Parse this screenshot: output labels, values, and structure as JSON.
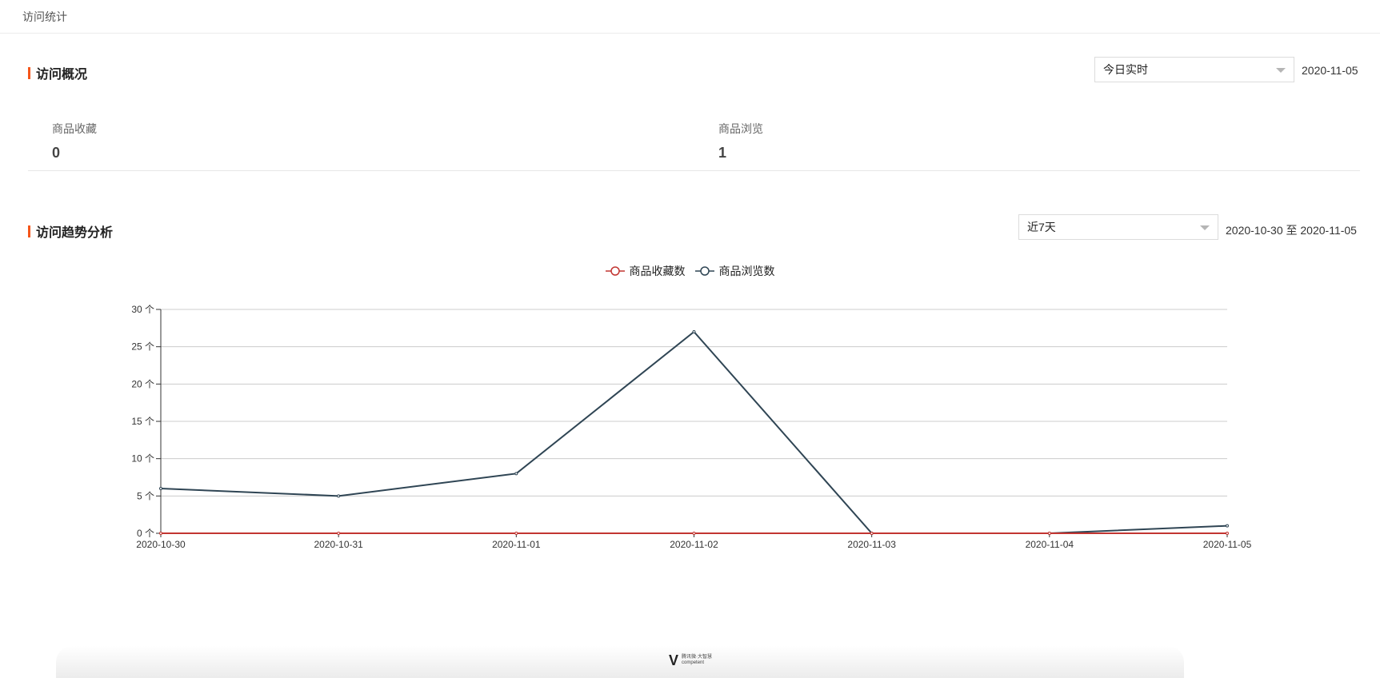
{
  "header": {
    "title": "访问统计"
  },
  "overview": {
    "title": "访问概况",
    "select_value": "今日实时",
    "date": "2020-11-05",
    "stats": [
      {
        "label": "商品收藏",
        "value": "0"
      },
      {
        "label": "商品浏览",
        "value": "1"
      }
    ]
  },
  "trend": {
    "title": "访问趋势分析",
    "select_value": "近7天",
    "date_range": "2020-10-30 至 2020-11-05"
  },
  "colors": {
    "accent": "#f5561b",
    "series_favorites": "#c23531",
    "series_views": "#2f4554",
    "grid": "#cccccc"
  },
  "chart_data": {
    "type": "line",
    "categories": [
      "2020-10-30",
      "2020-10-31",
      "2020-11-01",
      "2020-11-02",
      "2020-11-03",
      "2020-11-04",
      "2020-11-05"
    ],
    "series": [
      {
        "name": "商品收藏数",
        "values": [
          0,
          0,
          0,
          0,
          0,
          0,
          0
        ]
      },
      {
        "name": "商品浏览数",
        "values": [
          6,
          5,
          8,
          27,
          0,
          0,
          1
        ]
      }
    ],
    "yticks": [
      "0 个",
      "5 个",
      "10 个",
      "15 个",
      "20 个",
      "25 个",
      "30 个"
    ],
    "ylim": [
      0,
      30
    ],
    "grid": true,
    "legend": "top-center"
  },
  "footer": {
    "logo_mark": "V",
    "logo_text_line1": "腾讯微·大智慧",
    "logo_text_line2": "competent"
  }
}
